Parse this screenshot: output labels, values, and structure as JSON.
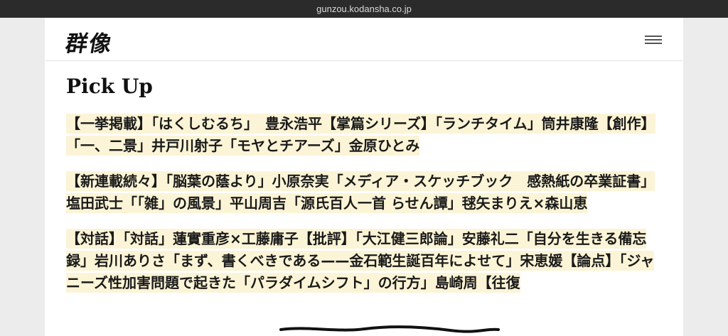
{
  "browser": {
    "url": "gunzou.kodansha.co.jp"
  },
  "header": {
    "logo": "群像",
    "menu_icon": "hamburger-menu-icon"
  },
  "main": {
    "section_title": "Pick Up",
    "items": [
      "【一挙掲載】「はくしむるち」　豊永浩平【掌篇シリーズ】「ランチタイム」筒井康隆【創作】「一、二景」井戸川射子「モヤとチアーズ」金原ひとみ",
      "【新連載続々】「脳葉の蔭より」小原奈実「メディア・スケッチブック　感熱紙の卒業証書」塩田武士「「雑」の風景」平山周吉「源氏百人一首 らせん譚」毬矢まりえ×森山恵",
      "【対話】「対話」蓮實重彦×工藤庸子【批評】「大江健三郎論」安藤礼二「自分を生きる備忘録」岩川ありさ「まず、書くべきである——金石範生誕百年によせて」宋恵媛【論点】「ジャニーズ性加害問題で起きた「パラダイムシフト」の行方」島崎周【往復"
    ],
    "highlight_color": "#fbf4d6"
  }
}
